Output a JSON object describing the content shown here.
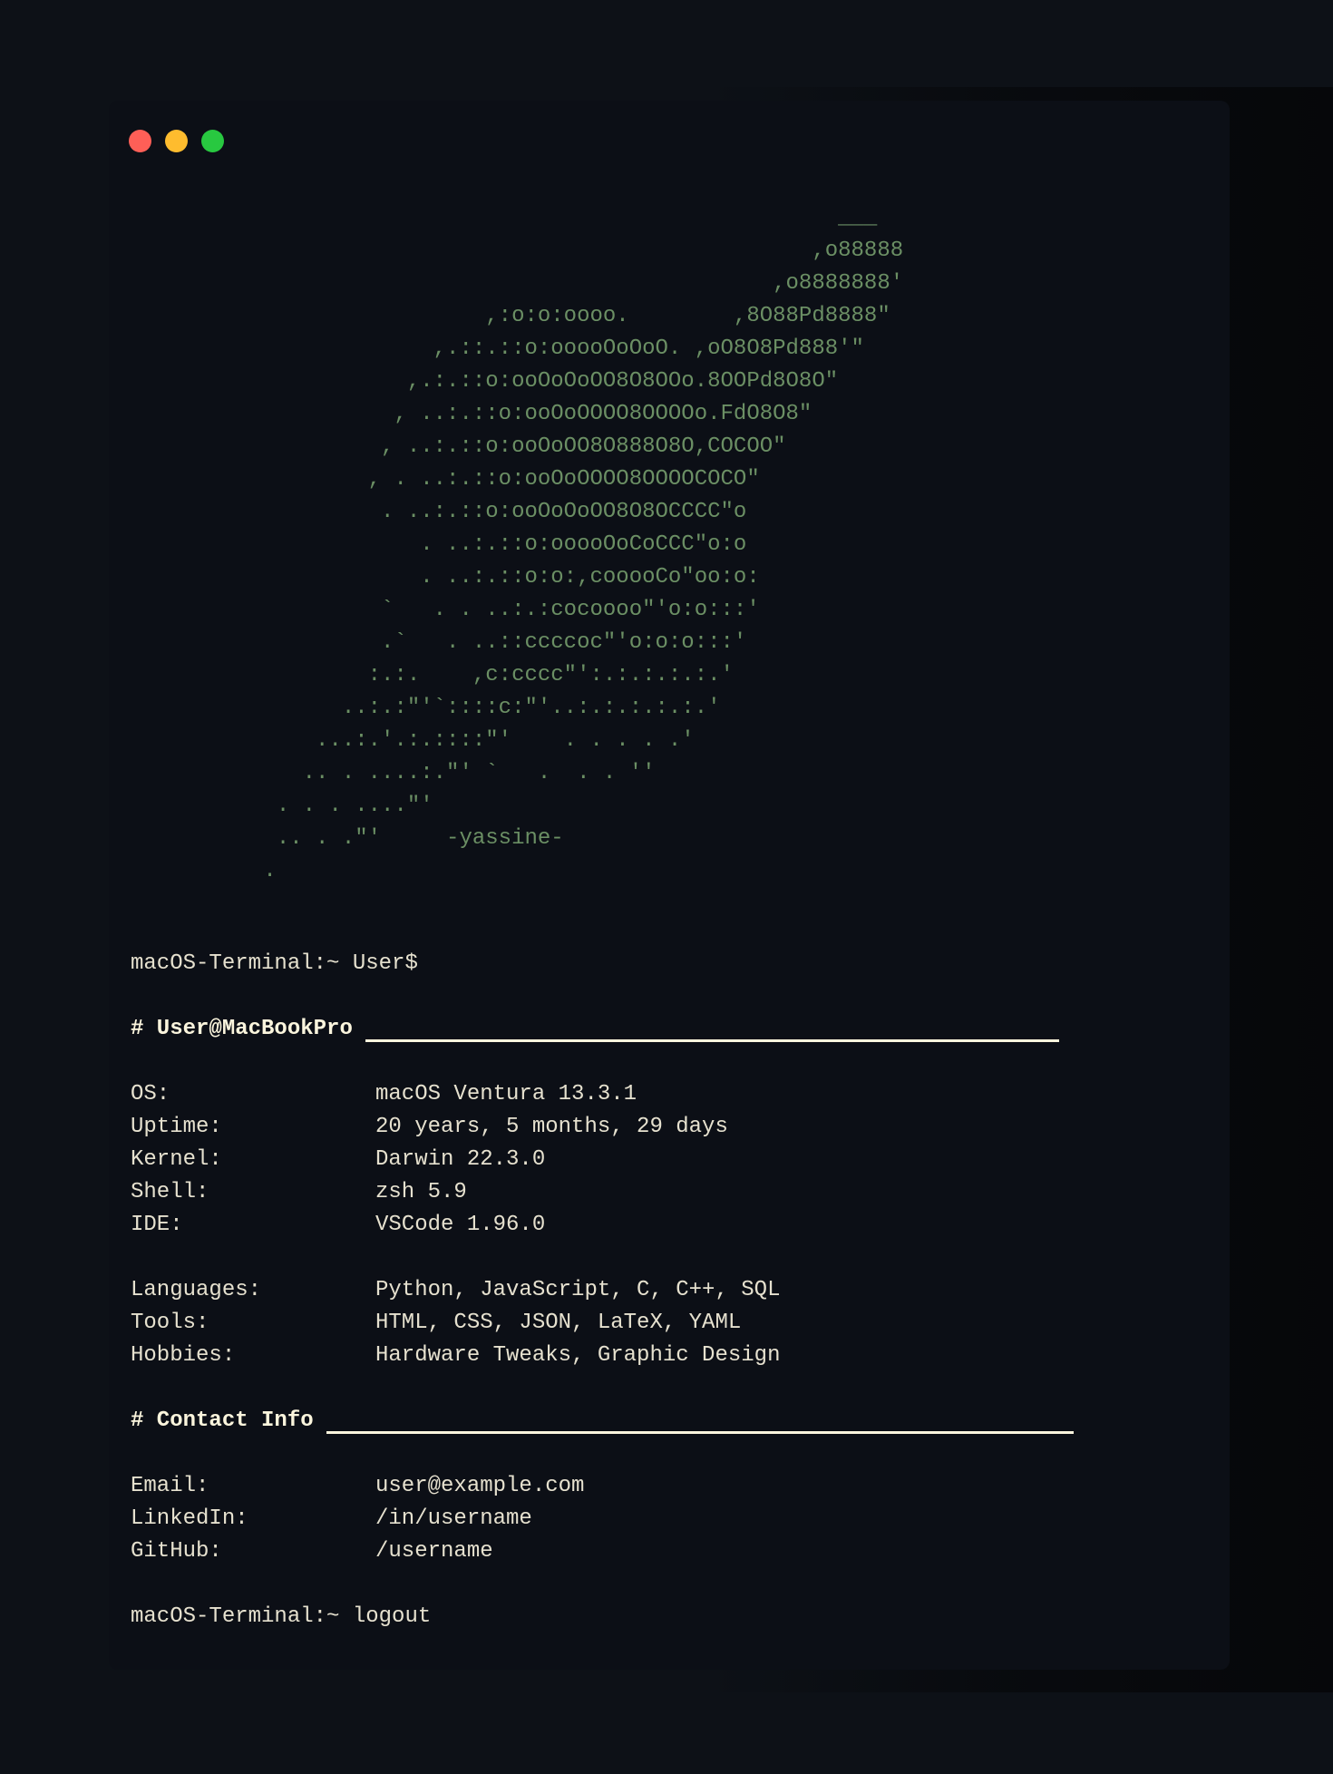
{
  "window": {
    "controls": [
      "close",
      "minimize",
      "zoom"
    ],
    "colors": {
      "close": "#fe5f57",
      "minimize": "#febc2e",
      "zoom": "#28c840",
      "ascii": "#6b8f64",
      "text": "#e6e1cf",
      "background": "#0c0f16"
    }
  },
  "ascii_art": "                                                       ___\n                                                     ,o88888\n                                                  ,o8888888'\n                            ,:o:o:oooo.        ,8O88Pd8888\"\n                        ,.::.::o:ooooOoOoO. ,oO8O8Pd888'\"\n                      ,.:.::o:ooOoOoOO8O8OOo.8OOPd8O8O\"\n                     , ..:.::o:ooOoOOOO8OOOOo.FdO8O8\"\n                    , ..:.::o:ooOoOO8O888O8O,COCOO\"\n                   , . ..:.::o:ooOoOOOO8OOOOCOCO\"\n                    . ..:.::o:ooOoOoOO8O8OCCCC\"o\n                       . ..:.::o:ooooOoCoCCC\"o:o\n                       . ..:.::o:o:,cooooCo\"oo:o:\n                    `   . . ..:.:cocoooo\"'o:o:::'\n                    .`   . ..::ccccoc\"'o:o:o:::'\n                   :.:.    ,c:cccc\"':.:.:.:.:.'\n                 ..:.:\"'`::::c:\"'..:.:.:.:.:.'\n               ...:.'.:.::::\"'    . . . . .'\n              .. . ....:.\"' `   .  . . ''\n            . . . ....\"'\n            .. . .\"'     -yassine-\n           .",
  "terminal": {
    "prompt": "macOS-Terminal:~ User$",
    "system": {
      "heading": "# User@MacBookPro",
      "rows": [
        {
          "label": "OS:",
          "value": "macOS Ventura 13.3.1"
        },
        {
          "label": "Uptime:",
          "value": "20 years, 5 months, 29 days"
        },
        {
          "label": "Kernel:",
          "value": "Darwin 22.3.0"
        },
        {
          "label": "Shell:",
          "value": "zsh 5.9"
        },
        {
          "label": "IDE:",
          "value": "VSCode 1.96.0"
        }
      ],
      "rows2": [
        {
          "label": "Languages:",
          "value": "Python, JavaScript, C, C++, SQL"
        },
        {
          "label": "Tools:",
          "value": "HTML, CSS, JSON, LaTeX, YAML"
        },
        {
          "label": "Hobbies:",
          "value": "Hardware Tweaks, Graphic Design"
        }
      ]
    },
    "contact": {
      "heading": "# Contact Info",
      "rows": [
        {
          "label": "Email:",
          "value": "user@example.com"
        },
        {
          "label": "LinkedIn:",
          "value": "/in/username"
        },
        {
          "label": "GitHub:",
          "value": "/username"
        }
      ]
    },
    "logout": "macOS-Terminal:~ logout"
  }
}
